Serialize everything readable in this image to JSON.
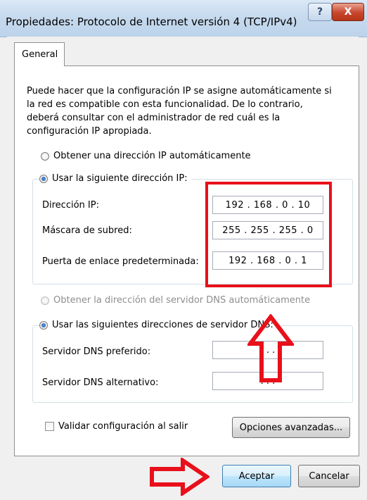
{
  "window": {
    "title": "Propiedades: Protocolo de Internet versión 4 (TCP/IPv4)",
    "help_label": "?",
    "close_label": "X"
  },
  "tabs": [
    {
      "label": "General",
      "selected": true
    }
  ],
  "description": "Puede hacer que la configuración IP se asigne automáticamente si la red es compatible con esta funcionalidad. De lo contrario, deberá consultar con el administrador de red cuál es la configuración IP apropiada.",
  "ip_section": {
    "auto_option": "Obtener una dirección IP automáticamente",
    "manual_option": "Usar la siguiente dirección IP:",
    "selected": "manual",
    "fields": [
      {
        "label": "Dirección IP:",
        "value": "192 . 168 .  0  . 10"
      },
      {
        "label": "Máscara de subred:",
        "value": "255 . 255 . 255 .  0"
      },
      {
        "label": "Puerta de enlace predeterminada:",
        "value": "192 . 168 .  0  .  1"
      }
    ]
  },
  "dns_section": {
    "auto_option": "Obtener la dirección del servidor DNS automáticamente",
    "auto_enabled": false,
    "manual_option": "Usar las siguientes direcciones de servidor DNS:",
    "selected": "manual",
    "fields": [
      {
        "label": "Servidor DNS preferido:",
        "value": ".     .     ."
      },
      {
        "label": "Servidor DNS alternativo:",
        "value": ".     .     ."
      }
    ]
  },
  "validate_checkbox": {
    "label": "Validar configuración al salir",
    "checked": false
  },
  "buttons": {
    "advanced": "Opciones avanzadas...",
    "ok": "Aceptar",
    "cancel": "Cancelar"
  },
  "annotation_color": "#e8101a"
}
